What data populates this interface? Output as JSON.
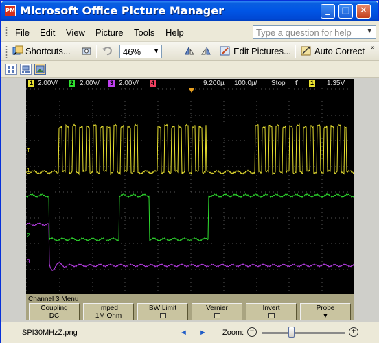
{
  "window": {
    "title": "Microsoft Office Picture Manager",
    "app_icon": "PM",
    "minimize": "_",
    "maximize": "□",
    "close": "✕"
  },
  "menu": {
    "items": [
      "File",
      "Edit",
      "View",
      "Picture",
      "Tools",
      "Help"
    ],
    "help_placeholder": "Type a question for help"
  },
  "toolbar": {
    "shortcuts": "Shortcuts...",
    "zoom": "46%",
    "edit_pictures": "Edit Pictures...",
    "auto_correct": "Auto Correct"
  },
  "scope": {
    "status": {
      "ch1_num": "1",
      "ch1_scale": "2.00V/",
      "ch2_num": "2",
      "ch2_scale": "2.00V/",
      "ch3_num": "3",
      "ch3_scale": "2.00V/",
      "ch4_num": "4",
      "delay": "9.200µ",
      "timebase": "100.0µ/",
      "run_state": "Stop",
      "trig_icon": "ť",
      "trig_ch": "1",
      "trig_level": "1.35V"
    },
    "colors": {
      "ch1": "#e8e030",
      "ch2": "#30e030",
      "ch3": "#c040f0",
      "ch4": "#f04060"
    },
    "menu_title": "Channel 3  Menu",
    "softkeys": [
      {
        "label": "Coupling",
        "value": "DC"
      },
      {
        "label": "Imped",
        "value": "1M Ohm"
      },
      {
        "label": "BW Limit",
        "value": ""
      },
      {
        "label": "Vernier",
        "value": ""
      },
      {
        "label": "Invert",
        "value": ""
      },
      {
        "label": "Probe",
        "value": ""
      }
    ]
  },
  "bottom": {
    "filename": "SPI30MHzZ.png",
    "zoom_label": "Zoom:",
    "zoom_level": 0.35
  }
}
